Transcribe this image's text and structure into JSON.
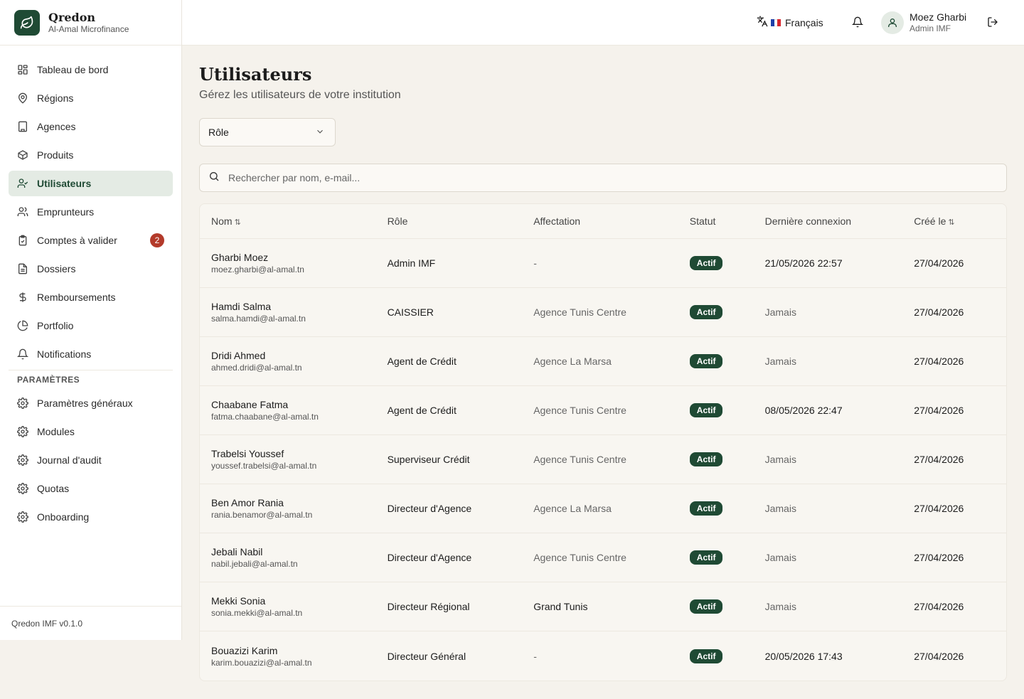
{
  "brand": {
    "name": "Qredon",
    "subtitle": "Al-Amal Microfinance"
  },
  "sidebar": {
    "items": [
      {
        "label": "Tableau de bord",
        "icon": "dashboard-icon",
        "active": false
      },
      {
        "label": "Régions",
        "icon": "map-pin-icon",
        "active": false
      },
      {
        "label": "Agences",
        "icon": "building-icon",
        "active": false
      },
      {
        "label": "Produits",
        "icon": "package-icon",
        "active": false
      },
      {
        "label": "Utilisateurs",
        "icon": "user-check-icon",
        "active": true
      },
      {
        "label": "Emprunteurs",
        "icon": "users-icon",
        "active": false
      },
      {
        "label": "Comptes à valider",
        "icon": "clipboard-check-icon",
        "active": false,
        "badge": "2"
      },
      {
        "label": "Dossiers",
        "icon": "file-icon",
        "active": false
      },
      {
        "label": "Remboursements",
        "icon": "dollar-icon",
        "active": false
      },
      {
        "label": "Portfolio",
        "icon": "pie-chart-icon",
        "active": false
      },
      {
        "label": "Notifications",
        "icon": "bell-icon",
        "active": false
      }
    ],
    "section_label": "PARAMÈTRES",
    "settings_items": [
      {
        "label": "Paramètres généraux",
        "icon": "gear-icon"
      },
      {
        "label": "Modules",
        "icon": "gear-icon"
      },
      {
        "label": "Journal d'audit",
        "icon": "gear-icon"
      },
      {
        "label": "Quotas",
        "icon": "gear-icon"
      },
      {
        "label": "Onboarding",
        "icon": "gear-icon"
      }
    ],
    "footer": "Qredon IMF v0.1.0"
  },
  "header": {
    "language": "Français",
    "user_name": "Moez Gharbi",
    "user_role": "Admin IMF"
  },
  "main": {
    "title": "Utilisateurs",
    "subtitle": "Gérez les utilisateurs de votre institution",
    "role_filter": "Rôle",
    "search_placeholder": "Rechercher par nom, e-mail..."
  },
  "table": {
    "columns": {
      "name": "Nom",
      "role": "Rôle",
      "assignment": "Affectation",
      "status": "Statut",
      "last_login": "Dernière connexion",
      "created": "Créé le"
    },
    "rows": [
      {
        "name": "Gharbi Moez",
        "email": "moez.gharbi@al-amal.tn",
        "role": "Admin IMF",
        "assignment": "-",
        "status": "Actif",
        "last_login": "21/05/2026 22:57",
        "created": "27/04/2026"
      },
      {
        "name": "Hamdi Salma",
        "email": "salma.hamdi@al-amal.tn",
        "role": "CAISSIER",
        "assignment": "Agence Tunis Centre",
        "status": "Actif",
        "last_login": "Jamais",
        "created": "27/04/2026"
      },
      {
        "name": "Dridi Ahmed",
        "email": "ahmed.dridi@al-amal.tn",
        "role": "Agent de Crédit",
        "assignment": "Agence La Marsa",
        "status": "Actif",
        "last_login": "Jamais",
        "created": "27/04/2026"
      },
      {
        "name": "Chaabane Fatma",
        "email": "fatma.chaabane@al-amal.tn",
        "role": "Agent de Crédit",
        "assignment": "Agence Tunis Centre",
        "status": "Actif",
        "last_login": "08/05/2026 22:47",
        "created": "27/04/2026"
      },
      {
        "name": "Trabelsi Youssef",
        "email": "youssef.trabelsi@al-amal.tn",
        "role": "Superviseur Crédit",
        "assignment": "Agence Tunis Centre",
        "status": "Actif",
        "last_login": "Jamais",
        "created": "27/04/2026"
      },
      {
        "name": "Ben Amor Rania",
        "email": "rania.benamor@al-amal.tn",
        "role": "Directeur d'Agence",
        "assignment": "Agence La Marsa",
        "status": "Actif",
        "last_login": "Jamais",
        "created": "27/04/2026"
      },
      {
        "name": "Jebali Nabil",
        "email": "nabil.jebali@al-amal.tn",
        "role": "Directeur d'Agence",
        "assignment": "Agence Tunis Centre",
        "status": "Actif",
        "last_login": "Jamais",
        "created": "27/04/2026"
      },
      {
        "name": "Mekki Sonia",
        "email": "sonia.mekki@al-amal.tn",
        "role": "Directeur Régional",
        "assignment": "Grand Tunis",
        "status": "Actif",
        "last_login": "Jamais",
        "created": "27/04/2026"
      },
      {
        "name": "Bouazizi Karim",
        "email": "karim.bouazizi@al-amal.tn",
        "role": "Directeur Général",
        "assignment": "-",
        "status": "Actif",
        "last_login": "20/05/2026 17:43",
        "created": "27/04/2026"
      }
    ]
  },
  "colors": {
    "accent": "#1f4a34",
    "badge_alert": "#b33a2a",
    "background": "#f5f2ec"
  }
}
